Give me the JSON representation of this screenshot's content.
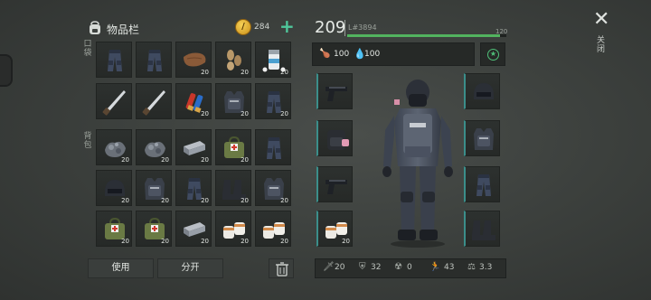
{
  "inventory": {
    "title": "物品栏",
    "coins": "284",
    "pockets_label": "口袋",
    "backpack_label": "背包",
    "pocket_slots": [
      {
        "item": "swat-pants",
        "count": ""
      },
      {
        "item": "swat-pants",
        "count": ""
      },
      {
        "item": "leather",
        "count": "20"
      },
      {
        "item": "seeds",
        "count": "20"
      },
      {
        "item": "pills-bottle",
        "count": "20"
      },
      {
        "item": "machete",
        "count": ""
      },
      {
        "item": "machete",
        "count": ""
      },
      {
        "item": "shotgun-shells",
        "count": "20"
      },
      {
        "item": "police-vest",
        "count": "20"
      },
      {
        "item": "swat-pants",
        "count": "20"
      }
    ],
    "backpack_slots": [
      {
        "item": "scrap-metal",
        "count": "20"
      },
      {
        "item": "scrap-metal",
        "count": "20"
      },
      {
        "item": "steel-bar",
        "count": "20"
      },
      {
        "item": "medical-bag",
        "count": "20"
      },
      {
        "item": "swat-pants",
        "count": ""
      },
      {
        "item": "swat-helmet",
        "count": "20"
      },
      {
        "item": "police-vest",
        "count": "20"
      },
      {
        "item": "swat-pants",
        "count": "20"
      },
      {
        "item": "boots",
        "count": "20"
      },
      {
        "item": "police-vest",
        "count": "20"
      },
      {
        "item": "medical-bag",
        "count": "20"
      },
      {
        "item": "medical-bag",
        "count": "20"
      },
      {
        "item": "steel-bar",
        "count": "20"
      },
      {
        "item": "bandages",
        "count": "20"
      },
      {
        "item": "bandages",
        "count": "20"
      }
    ],
    "use_label": "使用",
    "split_label": "分开"
  },
  "character": {
    "level": "209",
    "level_prefix": "L",
    "xp_current": "#3894",
    "xp_max": "120",
    "xp_fraction": 0.96,
    "food": "100",
    "water": "100",
    "weapon_slots": [
      {
        "item": "pistol",
        "count": ""
      },
      {
        "item": "backpack",
        "count": ""
      },
      {
        "item": "pistol",
        "count": ""
      },
      {
        "item": "bandages",
        "count": "20"
      }
    ],
    "armor_slots": [
      {
        "item": "swat-helmet",
        "count": ""
      },
      {
        "item": "police-vest",
        "count": ""
      },
      {
        "item": "swat-pants",
        "count": ""
      },
      {
        "item": "boots",
        "count": ""
      }
    ],
    "stats": {
      "damage": "20",
      "defense": "32",
      "radiation": "0",
      "speed": "43",
      "weight": "3.3"
    }
  },
  "close_label": "关闭",
  "colors": {
    "accent_green": "#4fc79b",
    "xp_green": "#52b35f",
    "slot_teal": "#3b8e8a"
  }
}
